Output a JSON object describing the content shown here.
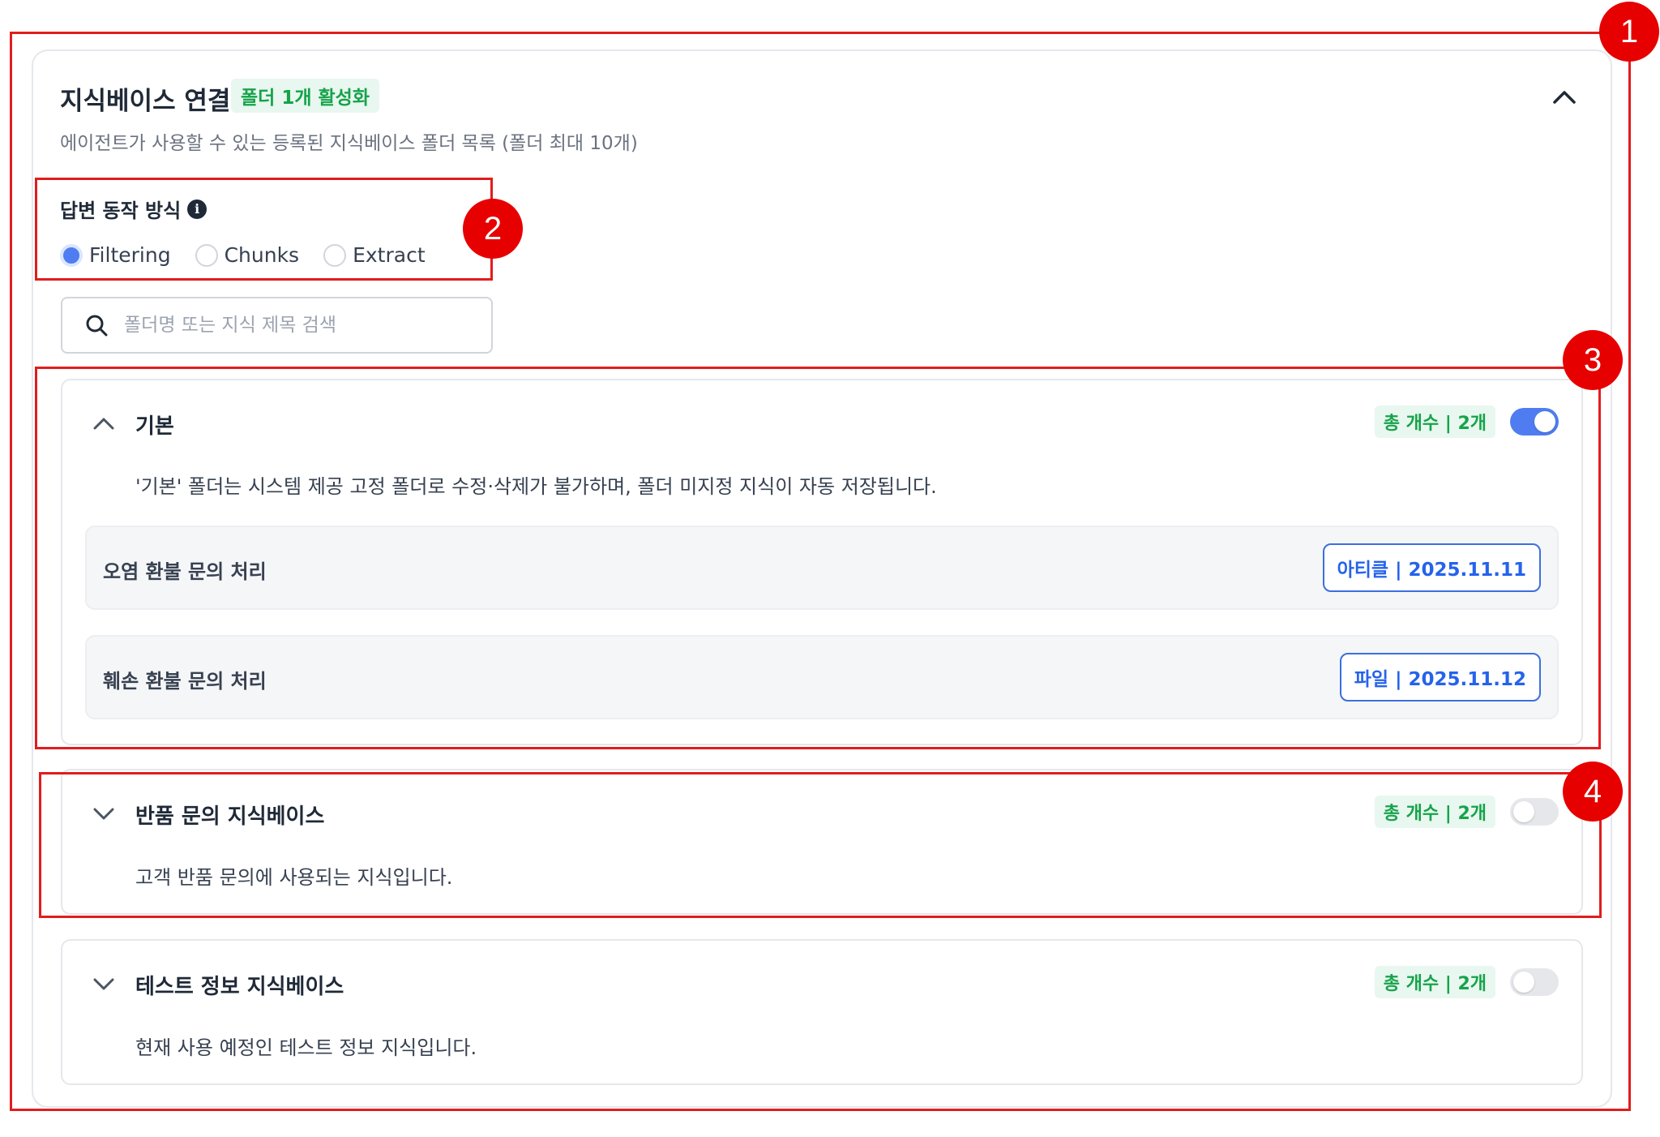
{
  "header": {
    "title": "지식베이스 연결",
    "active_badge": "폴더 1개 활성화",
    "description": "에이전트가 사용할 수 있는 등록된 지식베이스 폴더 목록 (폴더 최대 10개)",
    "collapse_icon": "chevron-up-icon"
  },
  "answer_mode": {
    "label": "답변 동작 방식",
    "info_icon": "i",
    "options": [
      {
        "label": "Filtering",
        "selected": true
      },
      {
        "label": "Chunks",
        "selected": false
      },
      {
        "label": "Extract",
        "selected": false
      }
    ]
  },
  "search": {
    "placeholder": "폴더명 또는 지식 제목 검색",
    "icon": "search-icon"
  },
  "folders": [
    {
      "name": "기본",
      "expanded": true,
      "count_badge": "총 개수 | 2개",
      "enabled": true,
      "description": "'기본' 폴더는 시스템 제공 고정 폴더로 수정·삭제가 불가하며, 폴더 미지정 지식이 자동 저장됩니다.",
      "items": [
        {
          "title": "오염 환불 문의 처리",
          "tag": "아티클 | 2025.11.11"
        },
        {
          "title": "훼손 환불 문의 처리",
          "tag": "파일 | 2025.11.12"
        }
      ]
    },
    {
      "name": "반품 문의 지식베이스",
      "expanded": false,
      "count_badge": "총 개수 | 2개",
      "enabled": false,
      "description": "고객 반품 문의에 사용되는 지식입니다."
    },
    {
      "name": "테스트 정보 지식베이스",
      "expanded": false,
      "count_badge": "총 개수 | 2개",
      "enabled": false,
      "description": "현재 사용 예정인 테스트 정보 지식입니다."
    }
  ],
  "annotations": {
    "markers": [
      "1",
      "2",
      "3",
      "4"
    ],
    "color": "#e60000"
  },
  "colors": {
    "accent": "#4f7df1",
    "badge_green": "#16a34a",
    "tag_blue": "#2563eb"
  }
}
